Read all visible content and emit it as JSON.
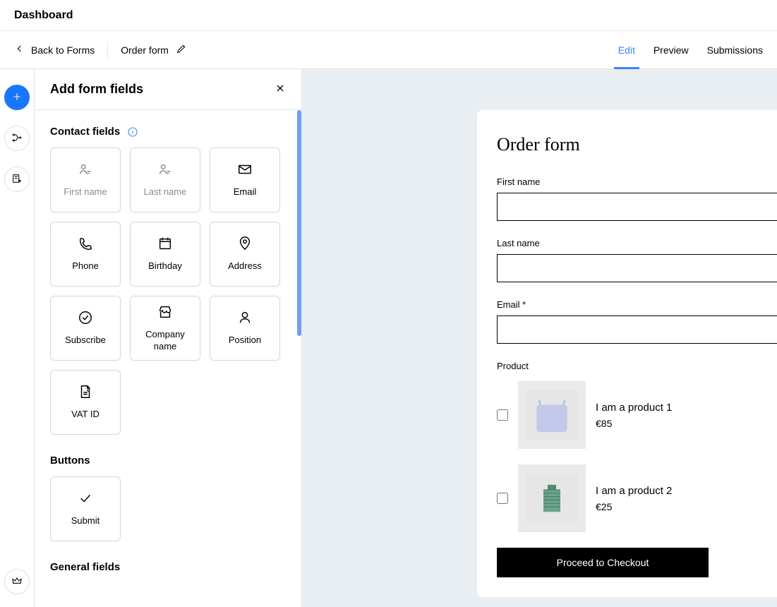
{
  "dashboard_title": "Dashboard",
  "subheader": {
    "back_label": "Back to Forms",
    "form_name": "Order form"
  },
  "tabs": {
    "edit": "Edit",
    "preview": "Preview",
    "submissions": "Submissions"
  },
  "panel": {
    "title": "Add form fields",
    "sections": {
      "contact": "Contact fields",
      "buttons": "Buttons",
      "general": "General fields"
    },
    "contact_fields": {
      "first_name": "First name",
      "last_name": "Last name",
      "email": "Email",
      "phone": "Phone",
      "birthday": "Birthday",
      "address": "Address",
      "subscribe": "Subscribe",
      "company": "Company name",
      "position": "Position",
      "vat": "VAT ID"
    },
    "button_fields": {
      "submit": "Submit"
    }
  },
  "form": {
    "title": "Order form",
    "first_name_label": "First name",
    "last_name_label": "Last name",
    "email_label": "Email *",
    "product_label": "Product",
    "products": [
      {
        "name": "I am a product 1",
        "price": "€85"
      },
      {
        "name": "I am a product 2",
        "price": "€25"
      }
    ],
    "checkout_label": "Proceed to Checkout"
  }
}
